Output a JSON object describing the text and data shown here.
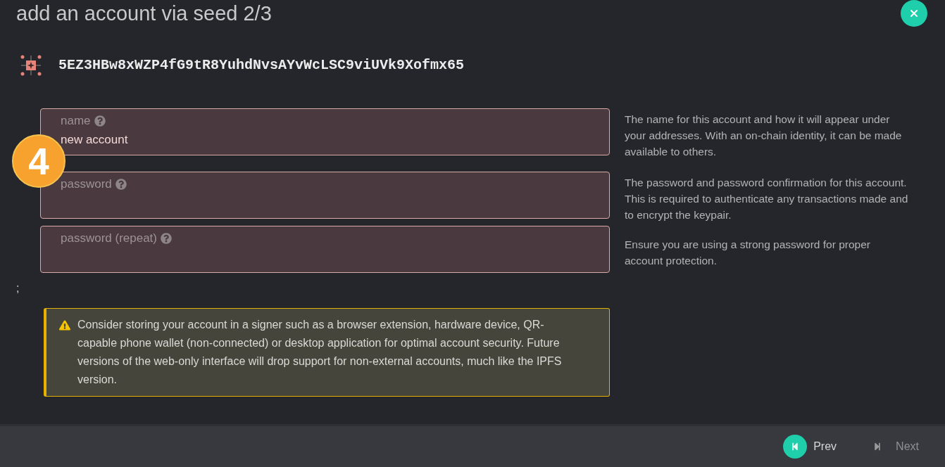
{
  "dialog": {
    "title": "add an account via seed 2/3"
  },
  "account": {
    "address": "5EZ3HBw8xWZP4fG9tR8YuhdNvsAYvWcLSC9viUVk9Xofmx65"
  },
  "sections": [
    {
      "fields": [
        {
          "label": "name",
          "value": "new account"
        }
      ],
      "help": [
        "The name for this account and how it will appear under your addresses. With an on-chain identity, it can be made available to others."
      ]
    },
    {
      "fields": [
        {
          "label": "password"
        },
        {
          "label": "password (repeat)"
        }
      ],
      "help": [
        "The password and password confirmation for this account. This is required to authenticate any transactions made and to encrypt the keypair.",
        "Ensure you are using a strong password for proper account protection."
      ]
    }
  ],
  "separator_text": ";",
  "warning": {
    "text": "Consider storing your account in a signer such as a browser extension, hardware device, QR-capable phone wallet (non-connected) or desktop application for optimal account security. Future versions of the web-only interface will drop support for non-external accounts, much like the IPFS version."
  },
  "step_badge": {
    "text": "4"
  },
  "footer": {
    "buttons": [
      {
        "kind": "prev",
        "label": "Prev",
        "disabled": false
      },
      {
        "kind": "next",
        "label": "Next",
        "disabled": true
      }
    ]
  }
}
